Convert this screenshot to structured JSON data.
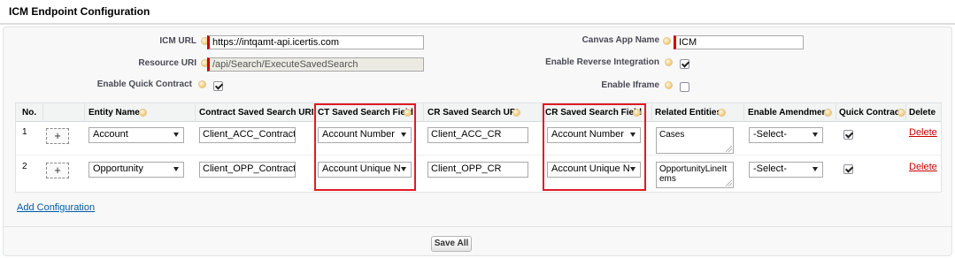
{
  "header": {
    "title": "ICM Endpoint Configuration"
  },
  "form": {
    "icm_url_label": "ICM URL",
    "icm_url_value": "https://intqamt-api.icertis.com",
    "resource_uri_label": "Resource URI",
    "resource_uri_value": "/api/Search/ExecuteSavedSearch",
    "enable_quick_contract_label": "Enable Quick Contract",
    "enable_quick_contract_checked": true,
    "canvas_app_name_label": "Canvas App Name",
    "canvas_app_name_value": "ICM",
    "enable_reverse_integration_label": "Enable Reverse Integration",
    "enable_reverse_integration_checked": true,
    "enable_iframe_label": "Enable Iframe",
    "enable_iframe_checked": false
  },
  "table": {
    "headers": {
      "no": "No.",
      "entity_name": "Entity Name",
      "contract_saved_search_uri": "Contract Saved Search URI",
      "ct_saved_search_field": "CT Saved Search Field",
      "cr_saved_search_uri": "CR Saved Search URI",
      "cr_saved_search_field": "CR Saved Search Field",
      "related_entities": "Related Entities",
      "enable_amendment": "Enable Amendment",
      "quick_contract": "Quick Contract",
      "delete": "Delete"
    },
    "rows": [
      {
        "no": "1",
        "add": "+",
        "entity_name": "Account",
        "contract_saved_search_uri": "Client_ACC_Contract",
        "ct_saved_search_field": "Account Number",
        "cr_saved_search_uri": "Client_ACC_CR",
        "cr_saved_search_field": "Account Number",
        "related_entities": "Cases",
        "enable_amendment": "-Select-",
        "quick_contract": true,
        "delete": "Delete"
      },
      {
        "no": "2",
        "add": "+",
        "entity_name": "Opportunity",
        "contract_saved_search_uri": "Client_OPP_Contract",
        "ct_saved_search_field": "Account Unique N",
        "cr_saved_search_uri": "Client_OPP_CR",
        "cr_saved_search_field": "Account Unique N",
        "related_entities": "OpportunityLineItems",
        "enable_amendment": "-Select-",
        "quick_contract": true,
        "delete": "Delete"
      }
    ]
  },
  "actions": {
    "add_configuration": "Add Configuration",
    "save_all": "Save All"
  },
  "colors": {
    "highlight": "#e01b24",
    "link": "#015ba7",
    "delete_link": "#cc0000",
    "required_bar": "#cc0000"
  },
  "icons": [
    "help-icon",
    "checkbox",
    "dropdown-arrow-icon",
    "plus-icon",
    "resize-grip-icon"
  ]
}
